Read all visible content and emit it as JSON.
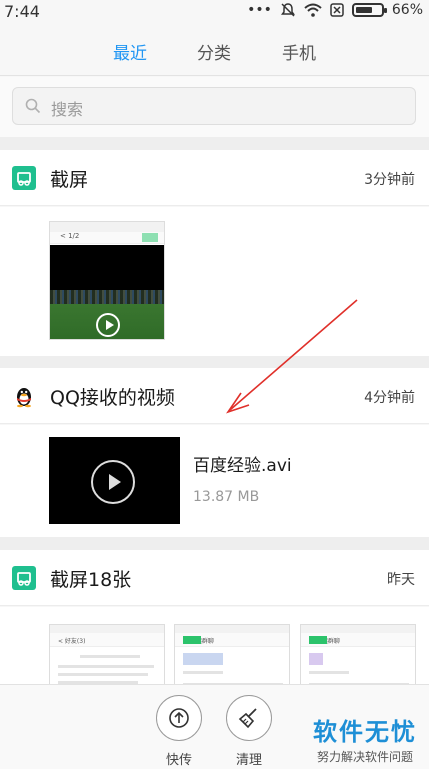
{
  "status_bar": {
    "time": "7:44",
    "more": "•••",
    "battery_percent": 66,
    "battery_text": "66%"
  },
  "tabs": [
    {
      "label": "最近",
      "active": true
    },
    {
      "label": "分类",
      "active": false
    },
    {
      "label": "手机",
      "active": false
    }
  ],
  "search": {
    "placeholder": "搜索"
  },
  "sections": [
    {
      "title": "截屏",
      "time": "3分钟前",
      "icon": "screenshot-icon",
      "thumb_page": "< 1/2"
    },
    {
      "title": "QQ接收的视频",
      "time": "4分钟前",
      "icon": "qq-penguin-icon",
      "file_name": "百度经验.avi",
      "file_size": "13.87 MB"
    },
    {
      "title": "截屏18张",
      "time": "昨天",
      "icon": "screenshot-icon",
      "thumbs": [
        "< 好友(3)",
        "< 发起群聊",
        "< 发起群聊"
      ]
    }
  ],
  "bottom_actions": [
    {
      "label": "快传",
      "icon": "upload-icon"
    },
    {
      "label": "清理",
      "icon": "broom-icon"
    }
  ],
  "watermark": {
    "main": "软件无忧",
    "sub": "努力解决软件问题"
  },
  "colors": {
    "accent": "#2196f3",
    "section_icon": "#1fbf8f",
    "watermark": "#1e8fd6",
    "annotation_arrow": "#e0302a"
  }
}
